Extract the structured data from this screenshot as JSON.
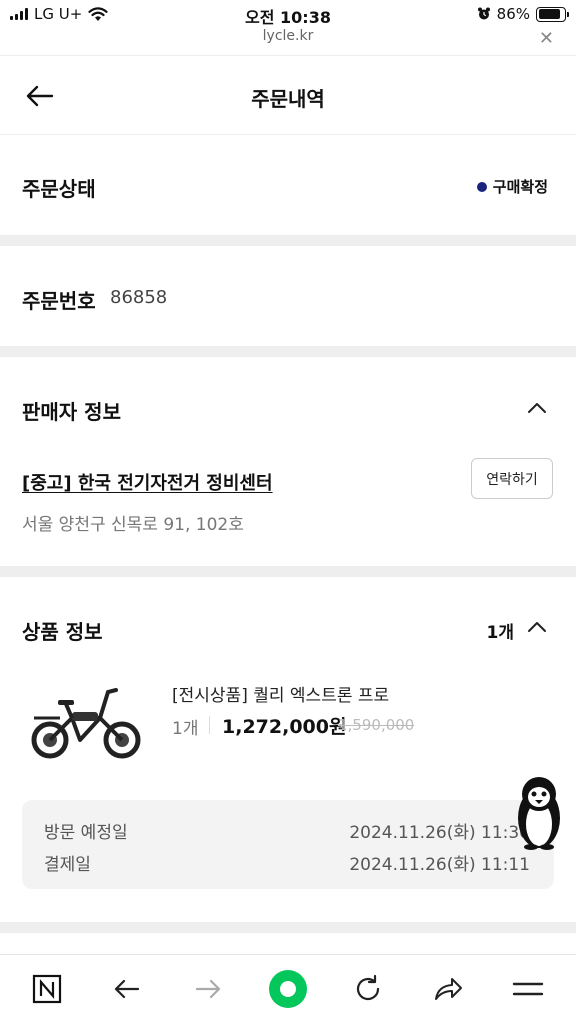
{
  "status_bar": {
    "carrier": "LG U+",
    "time": "오전 10:38",
    "battery_percent": "86%",
    "battery_level": 0.86
  },
  "browser": {
    "url": "lycle.kr",
    "close_icon": "close-icon"
  },
  "header": {
    "title": "주문내역",
    "back_icon": "arrow-left-icon"
  },
  "order_status": {
    "label": "주문상태",
    "value": "구매확정",
    "dot_color": "#1a237e"
  },
  "order_number": {
    "label": "주문번호",
    "value": "86858"
  },
  "seller": {
    "section_title": "판매자 정보",
    "name": "[중고] 한국 전기자전거 정비센터",
    "address": "서울 양천구 신목로 91, 102호",
    "contact_button": "연락하기"
  },
  "product": {
    "section_title": "상품 정보",
    "count": "1개",
    "name": "[전시상품] 퀄리 엑스트론 프로",
    "qty": "1개",
    "price": "1,272,000원",
    "original_price": "1,590,000",
    "image_icon": "electric-bike-image"
  },
  "schedule": {
    "visit_label": "방문 예정일",
    "visit_value": "2024.11.26(화) 11:30",
    "payment_label": "결제일",
    "payment_value": "2024.11.26(화) 11:11"
  },
  "bottom_nav": {
    "icons": [
      "naver-n-icon",
      "back-arrow-icon",
      "forward-arrow-icon",
      "green-dot-icon",
      "refresh-icon",
      "share-icon",
      "menu-icon"
    ],
    "accent": "#03c75a"
  }
}
